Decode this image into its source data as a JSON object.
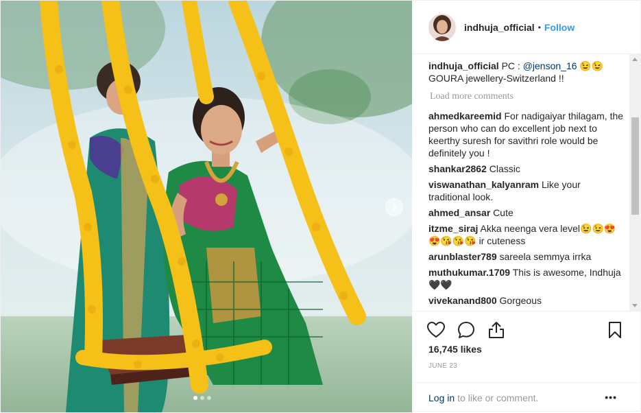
{
  "post": {
    "username": "indhuja_official",
    "separator": "•",
    "follow_label": "Follow",
    "media": {
      "photo": "woman-in-green-saree-on-marigold-swing",
      "next_icon": "chevron-right-icon",
      "carousel": {
        "count": 3,
        "active_index": 0
      }
    },
    "caption": {
      "username": "indhuja_official",
      "text_before_mention": "PC : ",
      "mention": "@jenson_16",
      "text_after_mention": " 😉😉 GOURA jewellery-Switzerland !!"
    },
    "load_more_label": "Load more comments",
    "comments": [
      {
        "username": "ahmedkareemid",
        "text": "For nadigaiyar thilagam, the person who can do excellent job next to keerthy suresh for savithri role would be definitely you !"
      },
      {
        "username": "shankar2862",
        "text": "Classic"
      },
      {
        "username": "viswanathan_kalyanram",
        "text": "Like your traditional look."
      },
      {
        "username": "ahmed_ansar",
        "text": "Cute"
      },
      {
        "username": "itzme_siraj",
        "text": "Akka neenga vera level😉😉😍😍😘😘😘 ir cuteness"
      },
      {
        "username": "arunblaster789",
        "text": "sareela semmya irrka"
      },
      {
        "username": "muthukumar.1709",
        "text": "This is awesome, Indhuja 🖤🖤"
      },
      {
        "username": "vivekanand800",
        "text": "Gorgeous"
      }
    ],
    "actions": {
      "like_icon": "heart-icon",
      "comment_icon": "comment-bubble-icon",
      "share_icon": "share-icon",
      "save_icon": "bookmark-icon"
    },
    "likes_label": "16,745 likes",
    "date_label": "JUNE 23",
    "login_link": "Log in",
    "login_suffix": "to like or comment.",
    "more_label": "•••"
  },
  "colors": {
    "link_blue": "#3897f0",
    "mention_blue": "#003569",
    "muted_gray": "#999999",
    "text": "#262626",
    "border": "#efefef"
  }
}
